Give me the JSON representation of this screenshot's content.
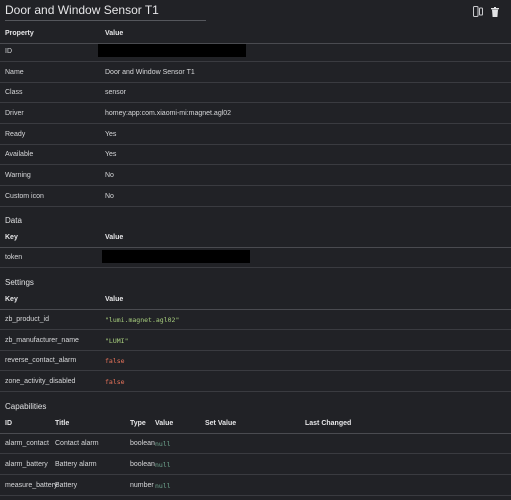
{
  "title": "Door and Window Sensor T1",
  "properties": {
    "header": {
      "property": "Property",
      "value": "Value"
    },
    "rows": [
      {
        "property": "ID",
        "value": ""
      },
      {
        "property": "Name",
        "value": "Door and Window Sensor T1"
      },
      {
        "property": "Class",
        "value": "sensor"
      },
      {
        "property": "Driver",
        "value": "homey:app:com.xiaomi-mi:magnet.agl02"
      },
      {
        "property": "Ready",
        "value": "Yes"
      },
      {
        "property": "Available",
        "value": "Yes"
      },
      {
        "property": "Warning",
        "value": "No"
      },
      {
        "property": "Custom icon",
        "value": "No"
      }
    ]
  },
  "data": {
    "heading": "Data",
    "header": {
      "key": "Key",
      "value": "Value"
    },
    "rows": [
      {
        "key": "token",
        "value": ""
      }
    ]
  },
  "settings": {
    "heading": "Settings",
    "header": {
      "key": "Key",
      "value": "Value"
    },
    "rows": [
      {
        "key": "zb_product_id",
        "value": "\"lumi.magnet.agl02\""
      },
      {
        "key": "zb_manufacturer_name",
        "value": "\"LUMI\""
      },
      {
        "key": "reverse_contact_alarm",
        "value": "false"
      },
      {
        "key": "zone_activity_disabled",
        "value": "false"
      }
    ]
  },
  "capabilities": {
    "heading": "Capabilities",
    "header": {
      "id": "ID",
      "title": "Title",
      "type": "Type",
      "value": "Value",
      "set_value": "Set Value",
      "last_changed": "Last Changed"
    },
    "rows": [
      {
        "id": "alarm_contact",
        "title": "Contact alarm",
        "type": "boolean",
        "value": "null"
      },
      {
        "id": "alarm_battery",
        "title": "Battery alarm",
        "type": "boolean",
        "value": "null"
      },
      {
        "id": "measure_battery",
        "title": "Battery",
        "type": "number",
        "value": "null"
      }
    ]
  },
  "icons": {
    "device": "device-icon",
    "delete": "trash-icon"
  },
  "colors": {
    "background": "#212226",
    "string": "#a8cf7e",
    "boolean": "#e8735a",
    "null": "#6fa78f"
  }
}
